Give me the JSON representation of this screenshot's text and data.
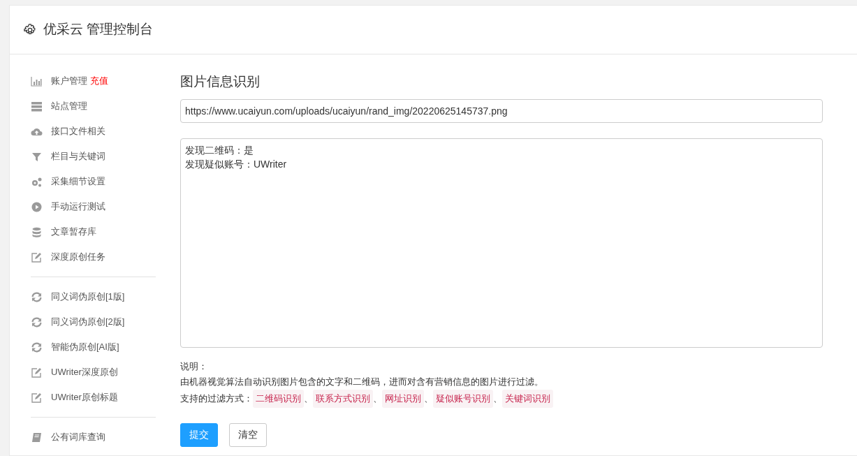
{
  "header": {
    "title": "优采云 管理控制台"
  },
  "sidebar": {
    "groups": [
      {
        "items": [
          {
            "label": "账户管理",
            "badge": "充值"
          },
          {
            "label": "站点管理"
          },
          {
            "label": "接口文件相关"
          },
          {
            "label": "栏目与关键词"
          },
          {
            "label": "采集细节设置"
          },
          {
            "label": "手动运行测试"
          },
          {
            "label": "文章暂存库"
          },
          {
            "label": "深度原创任务"
          }
        ]
      },
      {
        "items": [
          {
            "label": "同义词伪原创[1版]"
          },
          {
            "label": "同义词伪原创[2版]"
          },
          {
            "label": "智能伪原创[AI版]"
          },
          {
            "label": "UWriter深度原创"
          },
          {
            "label": "UWriter原创标题"
          }
        ]
      },
      {
        "items": [
          {
            "label": "公有词库查询"
          }
        ]
      }
    ]
  },
  "main": {
    "title": "图片信息识别",
    "url_field": {
      "value": "https://www.ucaiyun.com/uploads/ucaiyun/rand_img/20220625145737.png"
    },
    "result_box": {
      "lines": [
        "发现二维码：是",
        "发现疑似账号：UWriter"
      ]
    },
    "notes": {
      "heading": "说明：",
      "description": "由机器视觉算法自动识别图片包含的文字和二维码，进而对含有营销信息的图片进行过滤。",
      "filters_label": "支持的过滤方式：",
      "filters": [
        {
          "label": "二维码识别",
          "separator": "、"
        },
        {
          "label": "联系方式识别",
          "separator": "、"
        },
        {
          "label": "网址识别",
          "separator": "、"
        },
        {
          "label": "疑似账号识别",
          "separator": "、"
        },
        {
          "label": "关键词识别"
        }
      ]
    },
    "buttons": [
      {
        "label": "提交",
        "kind": "primary"
      },
      {
        "label": "清空",
        "kind": "secondary"
      }
    ]
  }
}
